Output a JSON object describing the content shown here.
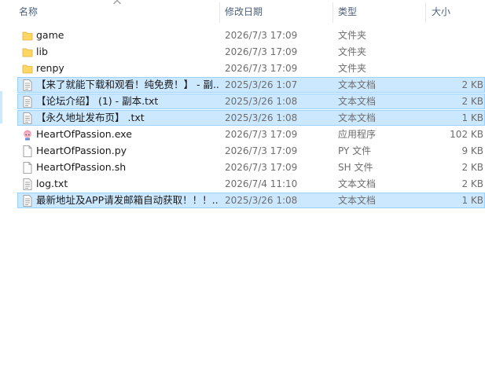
{
  "columns": {
    "name": "名称",
    "date": "修改日期",
    "type": "类型",
    "size": "大小"
  },
  "files": [
    {
      "name": "game",
      "date": "2026/7/3 17:09",
      "type": "文件夹",
      "size": "",
      "icon": "folder-icon",
      "selected": false
    },
    {
      "name": "lib",
      "date": "2026/7/3 17:09",
      "type": "文件夹",
      "size": "",
      "icon": "folder-icon",
      "selected": false
    },
    {
      "name": "renpy",
      "date": "2026/7/3 17:09",
      "type": "文件夹",
      "size": "",
      "icon": "folder-icon",
      "selected": false
    },
    {
      "name": "【来了就能下载和观看！纯免费！】 - 副...",
      "date": "2025/3/26 1:07",
      "type": "文本文档",
      "size": "2 KB",
      "icon": "text-file-icon",
      "selected": true
    },
    {
      "name": "【论坛介绍】 (1) - 副本.txt",
      "date": "2025/3/26 1:08",
      "type": "文本文档",
      "size": "2 KB",
      "icon": "text-file-icon",
      "selected": true
    },
    {
      "name": "【永久地址发布页】 .txt",
      "date": "2025/3/26 1:08",
      "type": "文本文档",
      "size": "1 KB",
      "icon": "text-file-icon",
      "selected": true
    },
    {
      "name": "HeartOfPassion.exe",
      "date": "2026/7/3 17:09",
      "type": "应用程序",
      "size": "102 KB",
      "icon": "app-exe-icon",
      "selected": false
    },
    {
      "name": "HeartOfPassion.py",
      "date": "2026/7/3 17:09",
      "type": "PY 文件",
      "size": "9 KB",
      "icon": "blank-file-icon",
      "selected": false
    },
    {
      "name": "HeartOfPassion.sh",
      "date": "2026/7/3 17:09",
      "type": "SH 文件",
      "size": "2 KB",
      "icon": "blank-file-icon",
      "selected": false
    },
    {
      "name": "log.txt",
      "date": "2026/7/4 11:10",
      "type": "文本文档",
      "size": "2 KB",
      "icon": "text-file-icon",
      "selected": false
    },
    {
      "name": "最新地址及APP请发邮箱自动获取！！！...",
      "date": "2025/3/26 1:08",
      "type": "文本文档",
      "size": "1 KB",
      "icon": "text-file-icon",
      "selected": true
    }
  ]
}
